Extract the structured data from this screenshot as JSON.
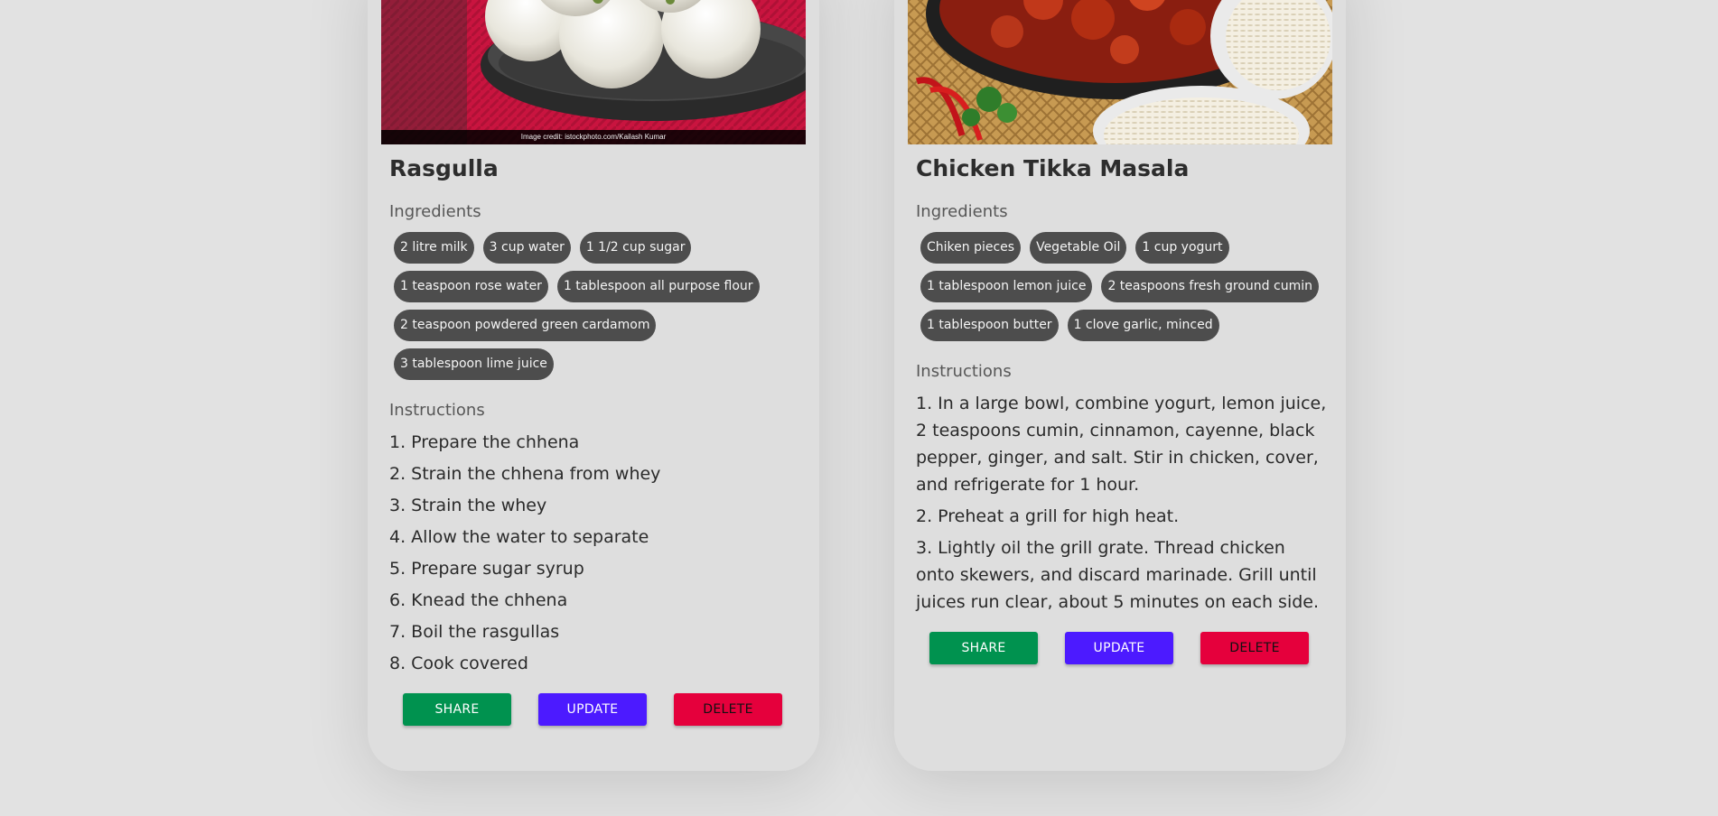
{
  "labels": {
    "ingredients": "Ingredients",
    "instructions": "Instructions",
    "share": "SHARE",
    "update": "UPDATE",
    "delete": "DELETE"
  },
  "recipes": [
    {
      "title": "Rasgulla",
      "image_credit": "Image credit: istockphoto.com/Kailash Kumar",
      "ingredients": [
        "2 litre milk",
        "3 cup water",
        "1 1/2 cup sugar",
        "1 teaspoon rose water",
        "1 tablespoon all purpose flour",
        "2 teaspoon powdered green cardamom",
        "3 tablespoon lime juice"
      ],
      "instructions": [
        "1. Prepare the chhena",
        "2. Strain the chhena from whey",
        "3. Strain the whey",
        "4. Allow the water to separate",
        "5. Prepare sugar syrup",
        "6. Knead the chhena",
        "7. Boil the rasgullas",
        "8. Cook covered"
      ]
    },
    {
      "title": "Chicken Tikka Masala",
      "ingredients": [
        "Chiken pieces",
        "Vegetable Oil",
        "1 cup yogurt",
        "1 tablespoon lemon juice",
        "2 teaspoons fresh ground cumin",
        "1 tablespoon butter",
        "1 clove garlic, minced"
      ],
      "instructions": [
        "1. In a large bowl, combine yogurt, lemon juice, 2 teaspoons cumin, cinnamon, cayenne, black pepper, ginger, and salt. Stir in chicken, cover, and refrigerate for 1 hour.",
        "2. Preheat a grill for high heat.",
        "3. Lightly oil the grill grate. Thread chicken onto skewers, and discard marinade. Grill until juices run clear, about 5 minutes on each side."
      ]
    }
  ],
  "colors": {
    "page_background": "#e2e2e2",
    "card_background": "#dedede",
    "chip_background": "#4d4d4d",
    "share_button": "#00924f",
    "update_button": "#4c1aff",
    "delete_button": "#e5003c"
  }
}
